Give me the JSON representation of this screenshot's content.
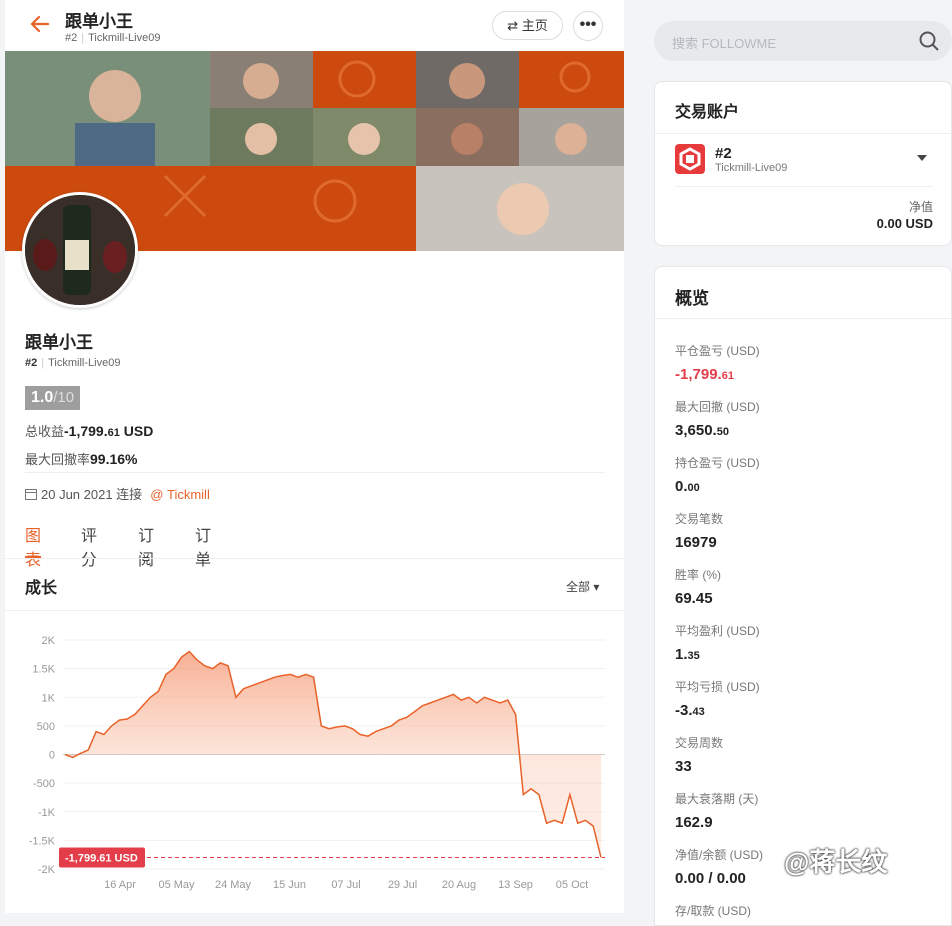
{
  "header": {
    "back_icon": "arrow-left-icon",
    "name": "跟单小王",
    "account_no": "#2",
    "server": "Tickmill-Live09",
    "home_label": "⇄ 主页",
    "more_label": "•••"
  },
  "profile": {
    "name": "跟单小王",
    "account_no": "#2",
    "server": "Tickmill-Live09",
    "score": "1.0",
    "score_max": "/10",
    "total_profit_label": "总收益",
    "total_profit_main": "-1,799.",
    "total_profit_dec": "61",
    "total_profit_unit": "USD",
    "max_drawdown_label": "最大回撤率",
    "max_drawdown_value": "99.16%",
    "connect_date": "20 Jun 2021 连接",
    "broker_link": "@ Tickmill"
  },
  "tabs": [
    {
      "label": "图表",
      "active": true
    },
    {
      "label": "评分",
      "active": false
    },
    {
      "label": "订阅",
      "active": false
    },
    {
      "label": "订单",
      "active": false
    }
  ],
  "growth": {
    "title": "成长",
    "range_label": "全部 ▾"
  },
  "chart_data": {
    "type": "area",
    "title": "",
    "xlabel": "",
    "ylabel": "",
    "ylim": [
      -2000,
      2000
    ],
    "yticks": [
      "2K",
      "1.5K",
      "1K",
      "500",
      "0",
      "-500",
      "-1K",
      "-1.5K",
      "-2K"
    ],
    "xticks": [
      "16 Apr",
      "05 May",
      "24 May",
      "15 Jun",
      "07 Jul",
      "29 Jul",
      "20 Aug",
      "13 Sep",
      "05 Oct"
    ],
    "current_label": "-1,799.61 USD",
    "series": [
      {
        "values": [
          0,
          -50,
          20,
          80,
          400,
          350,
          500,
          600,
          620,
          700,
          850,
          1000,
          1100,
          1400,
          1500,
          1700,
          1800,
          1650,
          1550,
          1500,
          1600,
          1550,
          1000,
          1150,
          1200,
          1250,
          1300,
          1350,
          1380,
          1400,
          1350,
          1400,
          1350,
          500,
          450,
          480,
          500,
          450,
          350,
          320,
          400,
          450,
          500,
          600,
          650,
          750,
          850,
          900,
          950,
          1000,
          1050,
          950,
          1000,
          900,
          1000,
          950,
          900,
          950,
          700,
          -700,
          -600,
          -700,
          -1200,
          -1150,
          -1200,
          -700,
          -1200,
          -1150,
          -1250,
          -1800
        ]
      }
    ]
  },
  "search": {
    "placeholder": "搜索 FOLLOWME"
  },
  "account_card": {
    "title": "交易账户",
    "account_no": "#2",
    "server": "Tickmill-Live09",
    "net_label": "净值",
    "net_value": "0.00 USD"
  },
  "overview": {
    "title": "概览",
    "items": [
      {
        "label": "平仓盈亏 (USD)",
        "main": "-1,799.",
        "dec": "61",
        "neg": true
      },
      {
        "label": "最大回撤 (USD)",
        "main": "3,650.",
        "dec": "50",
        "neg": false
      },
      {
        "label": "持仓盈亏 (USD)",
        "main": "0.",
        "dec": "00",
        "neg": false
      },
      {
        "label": "交易笔数",
        "main": "16979",
        "dec": "",
        "neg": false
      },
      {
        "label": "胜率 (%)",
        "main": "69.45",
        "dec": "",
        "neg": false
      },
      {
        "label": "平均盈利 (USD)",
        "main": "1.",
        "dec": "35",
        "neg": false
      },
      {
        "label": "平均亏损 (USD)",
        "main": "-3.",
        "dec": "43",
        "neg": false
      },
      {
        "label": "交易周数",
        "main": "33",
        "dec": "",
        "neg": false
      },
      {
        "label": "最大衰落期 (天)",
        "main": "162.9",
        "dec": "",
        "neg": false
      },
      {
        "label": "净值/余额 (USD)",
        "main": "0.00 / 0.00",
        "dec": "",
        "neg": false
      },
      {
        "label": "存/取款 (USD)",
        "main": "",
        "dec": "",
        "neg": false
      }
    ]
  },
  "watermark": "@蒋长纹",
  "colors": {
    "accent": "#e8622a",
    "negative": "#e43d4a",
    "banner_orange": "#cc4a0e"
  }
}
